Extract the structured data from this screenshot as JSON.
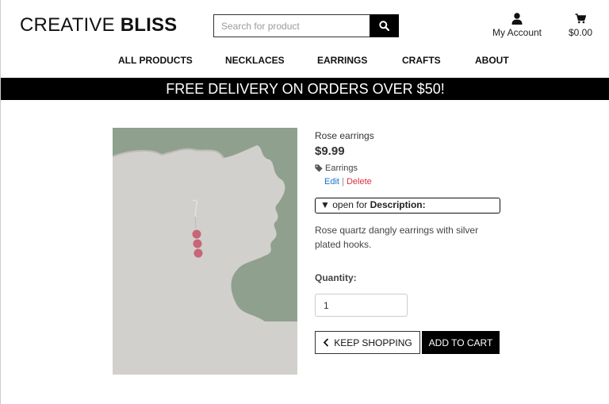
{
  "header": {
    "brand_light": "CREATIVE ",
    "brand_bold": "BLISS",
    "search_placeholder": "Search for product",
    "account_label": "My Account",
    "cart_total": "$0.00"
  },
  "nav": {
    "items": [
      "ALL PRODUCTS",
      "NECKLACES",
      "EARRINGS",
      "CRAFTS",
      "ABOUT"
    ]
  },
  "banner": "FREE DELIVERY ON ORDERS OVER $50!",
  "product": {
    "name": "Rose earrings",
    "price": "$9.99",
    "category": "Earrings",
    "edit_label": "Edit",
    "separator": "|",
    "delete_label": "Delete",
    "description_toggle_prefix": "open for ",
    "description_toggle_bold": "Description:",
    "description": "Rose quartz dangly earrings with silver plated hooks.",
    "quantity_label": "Quantity:",
    "quantity_value": "1",
    "keep_shopping_label": "KEEP SHOPPING",
    "add_to_cart_label": "ADD TO CART"
  },
  "colors": {
    "accent": "#000000",
    "link": "#1a73c7",
    "danger": "#d9303f",
    "photo_background": "#8fa08f"
  },
  "icons": {
    "search": "magnifier-icon",
    "account": "user-icon",
    "cart": "cart-icon",
    "category": "tag-icon",
    "toggle": "triangle-down-icon",
    "back": "chevron-left-icon"
  }
}
